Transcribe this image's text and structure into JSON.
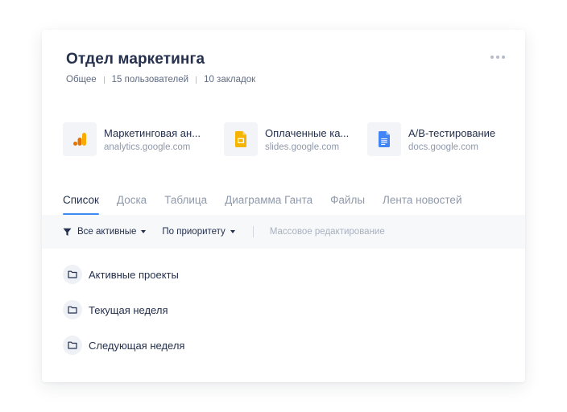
{
  "space": {
    "title": "Отдел маркетинга",
    "meta": [
      "Общее",
      "15 пользователей",
      "10 закладок"
    ]
  },
  "bookmarks": [
    {
      "name": "Маркетинговая ан...",
      "url": "analytics.google.com",
      "icon": "google-analytics-icon",
      "color": "#f9ab00"
    },
    {
      "name": "Оплаченные ка...",
      "url": "slides.google.com",
      "icon": "google-slides-icon",
      "color": "#f4b400"
    },
    {
      "name": "A/B-тестирование",
      "url": "docs.google.com",
      "icon": "google-docs-icon",
      "color": "#4285f4"
    }
  ],
  "tabs": [
    {
      "label": "Список",
      "active": true
    },
    {
      "label": "Доска",
      "active": false
    },
    {
      "label": "Таблица",
      "active": false
    },
    {
      "label": "Диаграмма Ганта",
      "active": false
    },
    {
      "label": "Файлы",
      "active": false
    },
    {
      "label": "Лента новостей",
      "active": false
    }
  ],
  "toolbar": {
    "filter_label": "Все активные",
    "sort_label": "По приоритету",
    "bulk_edit_label": "Массовое редактирование"
  },
  "folders": [
    {
      "label": "Активные проекты"
    },
    {
      "label": "Текущая неделя"
    },
    {
      "label": "Следующая неделя"
    }
  ],
  "colors": {
    "accent": "#3d8bf2",
    "text": "#24304d",
    "muted": "#8f99ab"
  }
}
